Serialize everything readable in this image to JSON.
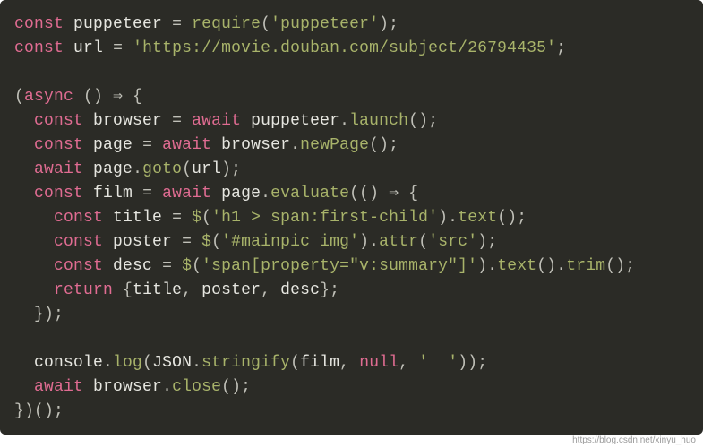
{
  "tokens": {
    "l1": {
      "kw1": "const",
      "id1": "puppeteer",
      "fn": "require",
      "str": "'puppeteer'"
    },
    "l2": {
      "kw1": "const",
      "id1": "url",
      "str": "'https://movie.douban.com/subject/26794435'"
    },
    "l4": {
      "kw": "async",
      "arrow": "⇒"
    },
    "l5": {
      "kw1": "const",
      "id1": "browser",
      "kw2": "await",
      "id2": "puppeteer",
      "fn": "launch"
    },
    "l6": {
      "kw1": "const",
      "id1": "page",
      "kw2": "await",
      "id2": "browser",
      "fn": "newPage"
    },
    "l7": {
      "kw": "await",
      "id1": "page",
      "fn": "goto",
      "arg": "url"
    },
    "l8": {
      "kw1": "const",
      "id1": "film",
      "kw2": "await",
      "id2": "page",
      "fn": "evaluate",
      "arrow": "⇒"
    },
    "l9": {
      "kw": "const",
      "id": "title",
      "fn1": "$",
      "str": "'h1 > span:first-child'",
      "fn2": "text"
    },
    "l10": {
      "kw": "const",
      "id": "poster",
      "fn1": "$",
      "str1": "'#mainpic img'",
      "fn2": "attr",
      "str2": "'src'"
    },
    "l11": {
      "kw": "const",
      "id": "desc",
      "fn1": "$",
      "str": "'span[property=\"v:summary\"]'",
      "fn2": "text",
      "fn3": "trim"
    },
    "l12": {
      "kw": "return",
      "id1": "title",
      "id2": "poster",
      "id3": "desc"
    },
    "l15": {
      "id1": "console",
      "fn1": "log",
      "id2": "JSON",
      "fn2": "stringify",
      "arg1": "film",
      "kw": "null",
      "str": "'  '"
    },
    "l16": {
      "kw": "await",
      "id": "browser",
      "fn": "close"
    }
  },
  "watermark": "https://blog.csdn.net/xinyu_huo"
}
